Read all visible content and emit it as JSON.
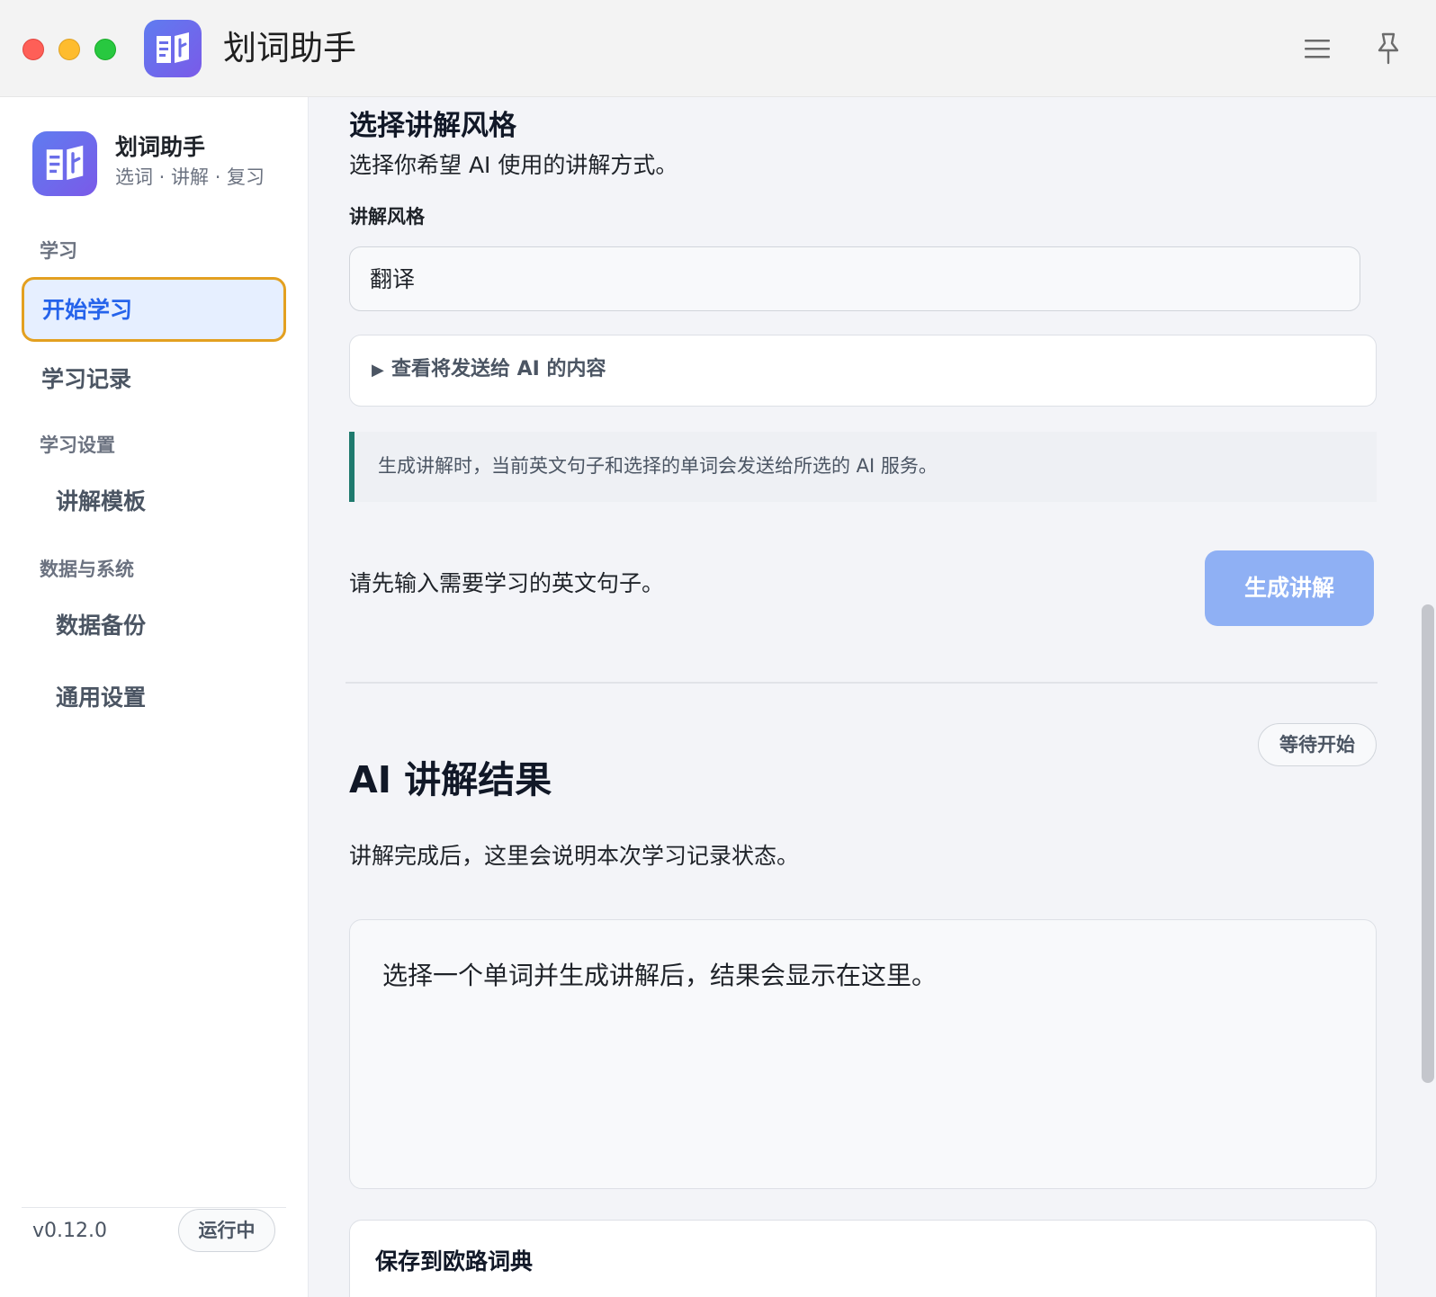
{
  "window": {
    "title": "划词助手"
  },
  "sidebar": {
    "brand_name": "划词助手",
    "brand_subtitle": "选词 · 讲解 · 复习",
    "sections": [
      {
        "label": "学习"
      },
      {
        "label": "学习设置"
      },
      {
        "label": "数据与系统"
      }
    ],
    "items": [
      {
        "label": "开始学习",
        "active": true
      },
      {
        "label": "学习记录"
      },
      {
        "label": "讲解模板"
      },
      {
        "label": "数据备份"
      },
      {
        "label": "通用设置"
      }
    ],
    "version": "v0.12.0",
    "status": "运行中"
  },
  "main": {
    "style_section": {
      "heading": "选择讲解风格",
      "description": "选择你希望 AI 使用的讲解方式。",
      "field_label": "讲解风格",
      "selected_value": "翻译",
      "details_label": "查看将发送给 AI 的内容",
      "note": "生成讲解时，当前英文句子和选择的单词会发送给所选的 AI 服务。"
    },
    "action": {
      "hint": "请先输入需要学习的英文句子。",
      "generate_button": "生成讲解",
      "generate_disabled": true
    },
    "result": {
      "status_badge": "等待开始",
      "heading": "AI 讲解结果",
      "description": "讲解完成后，这里会说明本次学习记录状态。",
      "placeholder": "选择一个单词并生成讲解后，结果会显示在这里。"
    },
    "save": {
      "heading": "保存到欧路词典"
    }
  },
  "colors": {
    "accent": "#2563eb",
    "active_outline": "#e3a020",
    "button_disabled": "#8fb0f4",
    "note_border": "#1f7a6e"
  },
  "icons": {
    "app": "book-icon",
    "menu": "hamburger-menu-icon",
    "pin": "pin-icon"
  }
}
